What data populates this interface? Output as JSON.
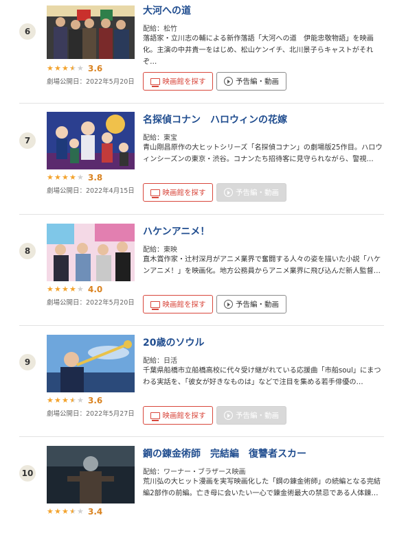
{
  "labels": {
    "find_theater": "映画館を探す",
    "trailer": "予告編・動画"
  },
  "accent_colors": {
    "title": "#204d8f",
    "star": "#f3a32d",
    "score": "#d9821f",
    "theater_button": "#d8453a"
  },
  "movies": [
    {
      "rank": "6",
      "title": "大河への道",
      "distributor": "配給：松竹",
      "description": "落語家・立川志の輔による新作落語「大河への道　伊能忠敬物語」を映画化。主演の中井貴一をはじめ、松山ケンイチ、北川景子らキャストがそれぞ…",
      "rating": 3.5,
      "score": "3.6",
      "release": "劇場公開日：2022年5月20日",
      "trailer_enabled": true
    },
    {
      "rank": "7",
      "title": "名探偵コナン　ハロウィンの花嫁",
      "distributor": "配給：東宝",
      "description": "青山剛昌原作の大ヒットシリーズ「名探偵コナン」の劇場版25作目。ハロウィンシーズンの東京・渋谷。コナンたち招待客に見守られながら、警視…",
      "rating": 4,
      "score": "3.8",
      "release": "劇場公開日：2022年4月15日",
      "trailer_enabled": false
    },
    {
      "rank": "8",
      "title": "ハケンアニメ！",
      "distributor": "配給：東映",
      "description": "直木賞作家・辻村深月がアニメ業界で奮闘する人々の姿を描いた小説「ハケンアニメ！」を映画化。地方公務員からアニメ業界に飛び込んだ新人監督…",
      "rating": 4,
      "score": "4.0",
      "release": "劇場公開日：2022年5月20日",
      "trailer_enabled": true
    },
    {
      "rank": "9",
      "title": "20歳のソウル",
      "distributor": "配給：日活",
      "description": "千葉県船橋市立船橋高校に代々受け継がれている応援曲「市船soul」にまつわる実話を、「彼女が好きなものは」などで注目を集める若手俳優の…",
      "rating": 3.5,
      "score": "3.6",
      "release": "劇場公開日：2022年5月27日",
      "trailer_enabled": false
    },
    {
      "rank": "10",
      "title": "鋼の錬金術師　完結編　復讐者スカー",
      "distributor": "配給：ワーナー・ブラザース映画",
      "description": "荒川弘の大ヒット漫画を実写映画化した「鋼の錬金術師」の続編となる完結編2部作の前編。亡き母に会いたい一心で錬金術最大の禁忌である人体錬…",
      "rating": 3.5,
      "score": "3.4",
      "release": "",
      "trailer_enabled": true
    }
  ]
}
